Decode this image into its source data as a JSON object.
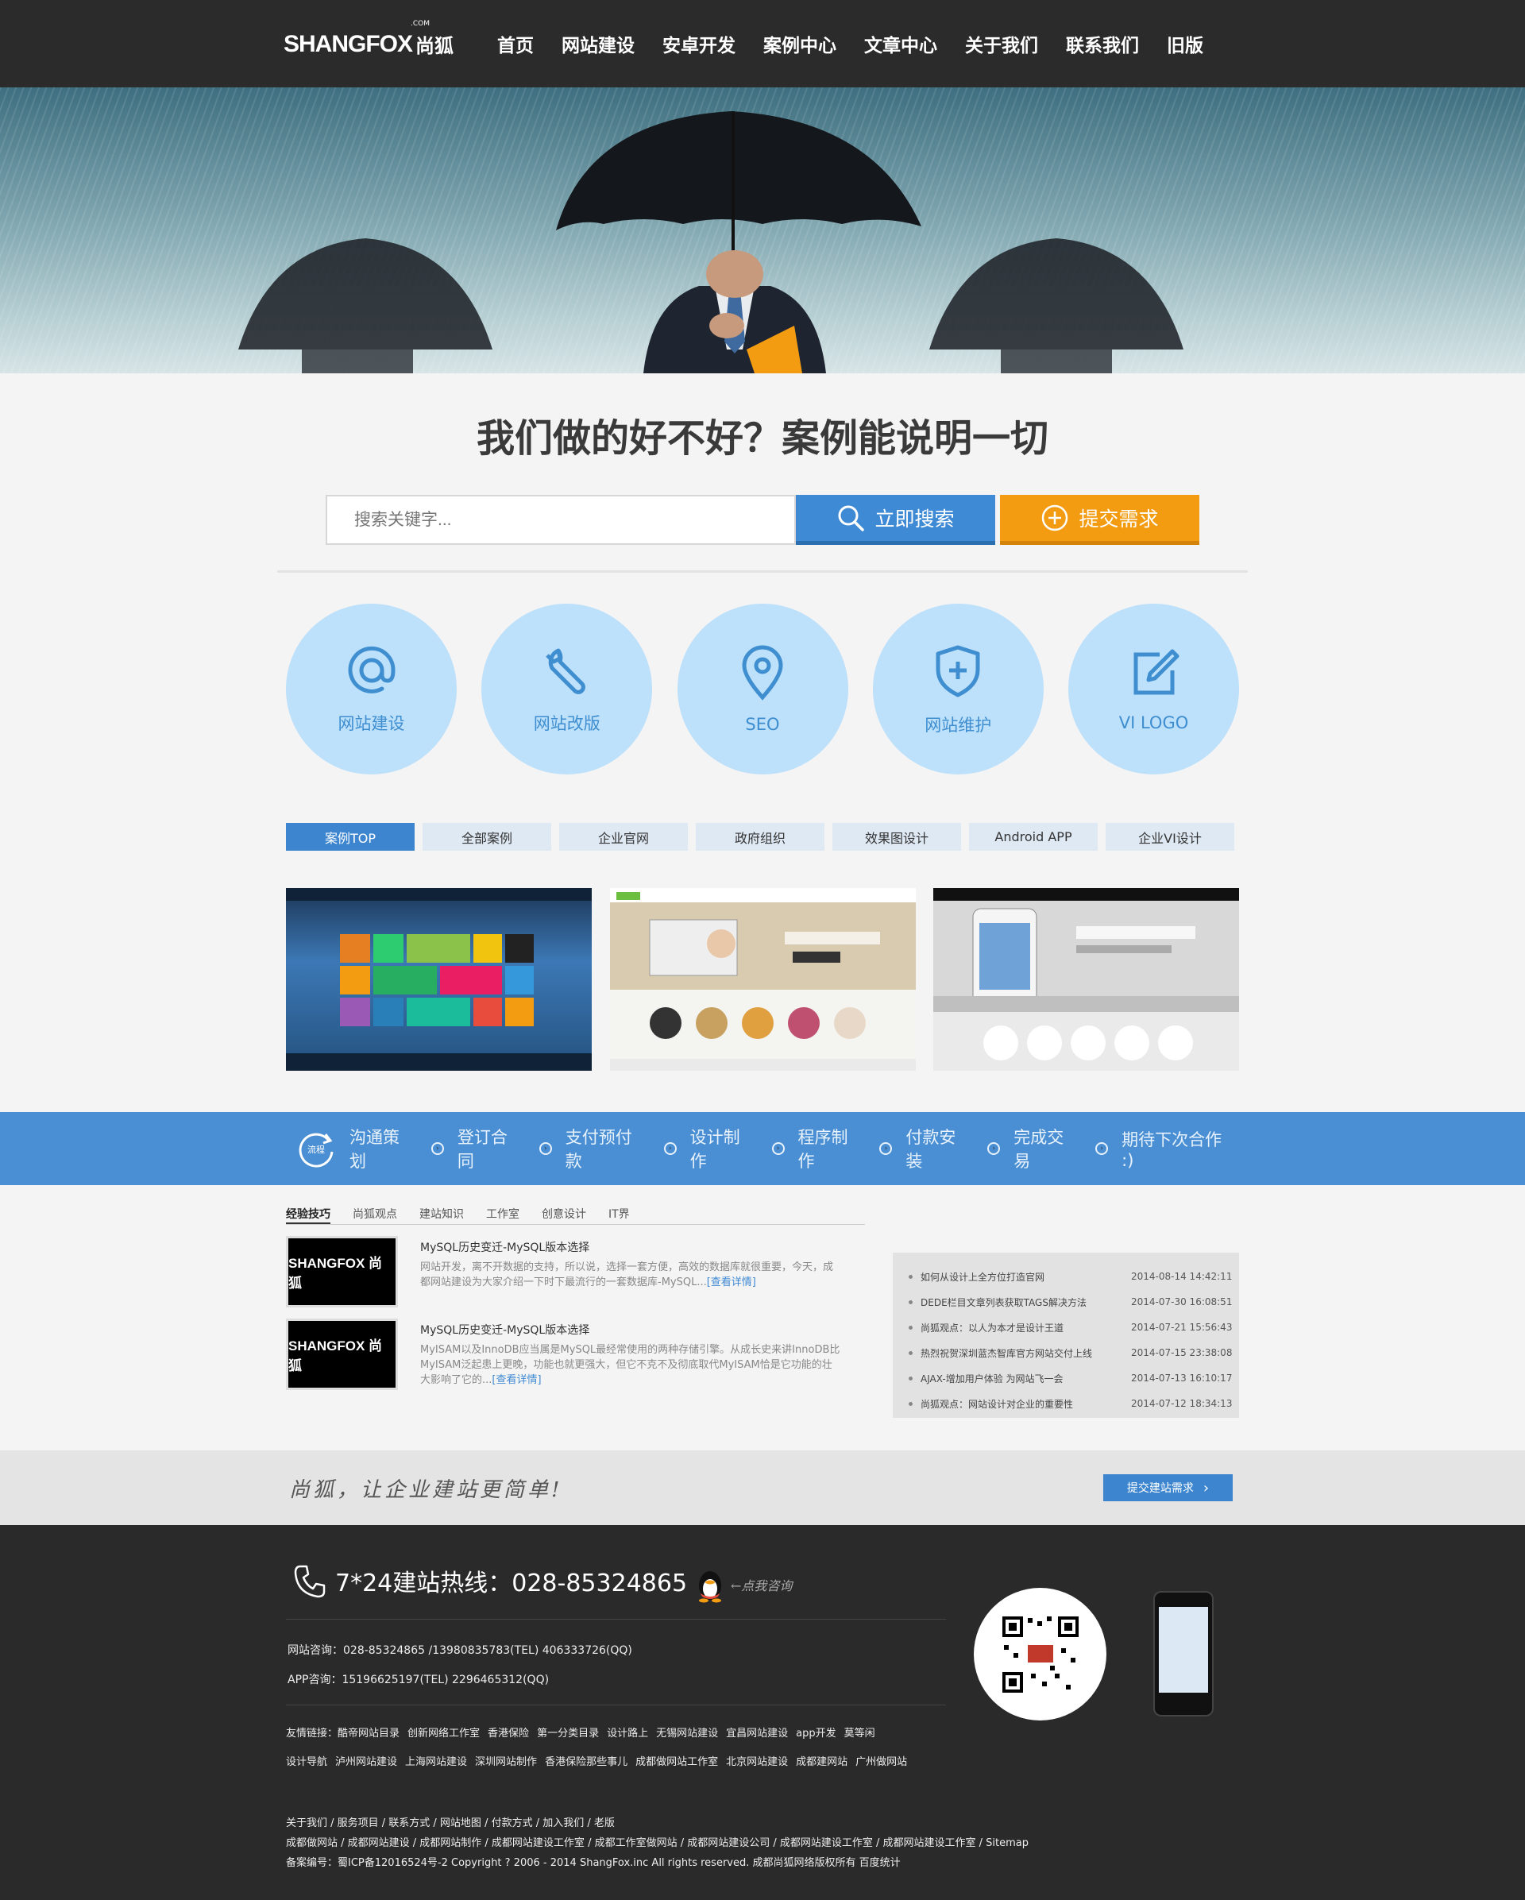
{
  "header": {
    "logo_text": "SHANGFOX",
    "logo_cn": "尚狐",
    "logo_suffix": ".COM",
    "nav": [
      "首页",
      "网站建设",
      "安卓开发",
      "案例中心",
      "文章中心",
      "关于我们",
      "联系我们",
      "旧版"
    ]
  },
  "cases": {
    "headline": "我们做的好不好？案例能说明一切",
    "search_placeholder": "搜索关键字...",
    "search_button": "立即搜索",
    "submit_button": "提交需求"
  },
  "services": [
    "网站建设",
    "网站改版",
    "SEO",
    "网站维护",
    "VI LOGO"
  ],
  "case_tabs": [
    "案例TOP",
    "全部案例",
    "企业官网",
    "政府组织",
    "效果图设计",
    "Android APP",
    "企业VI设计"
  ],
  "process": {
    "badge": "流程",
    "steps": [
      "沟通策划",
      "登订合同",
      "支付预付款",
      "设计制作",
      "程序制作",
      "付款安装",
      "完成交易",
      "期待下次合作 :)"
    ]
  },
  "news": {
    "tabs": [
      "经验技巧",
      "尚狐观点",
      "建站知识",
      "工作室",
      "创意设计",
      "IT界"
    ],
    "articles": [
      {
        "thumb": "SHANGFOX 尚狐",
        "title": "MySQL历史变迁-MySQL版本选择",
        "desc": "网站开发，离不开数据的支持，所以说，选择一套方便，高效的数据库就很重要，今天，成都网站建设为大家介绍一下时下最流行的一套数据库-MySQL...",
        "more": "[查看详情]"
      },
      {
        "thumb": "SHANGFOX 尚狐",
        "title": "MySQL历史变迁-MySQL版本选择",
        "desc": "MyISAM以及InnoDB应当属是MySQL最经常使用的两种存储引擎。从成长史来讲InnoDB比MyISAM泛起患上更晚，功能也就更强大，但它不克不及彻底取代MyISAM恰是它功能的壮大影响了它的...",
        "more": "[查看详情]"
      }
    ],
    "list": [
      {
        "title": "如何从设计上全方位打造官网",
        "date": "2014-08-14  14:42:11"
      },
      {
        "title": "DEDE栏目文章列表获取TAGS解决方法",
        "date": "2014-07-30  16:08:51"
      },
      {
        "title": "尚狐观点：以人为本才是设计王道",
        "date": "2014-07-21  15:56:43"
      },
      {
        "title": "热烈祝贺深圳蓝杰智库官方网站交付上线",
        "date": "2014-07-15  23:38:08"
      },
      {
        "title": "AJAX-增加用户体验 为网站飞一会",
        "date": "2014-07-13  16:10:17"
      },
      {
        "title": "尚狐观点：网站设计对企业的重要性",
        "date": "2014-07-12  18:34:13"
      }
    ]
  },
  "slogan": {
    "text": "尚狐，让企业建站更简单!",
    "button": "提交建站需求"
  },
  "footer": {
    "hotline": "7*24建站热线：028-85324865",
    "qq_text": "←点我咨询",
    "contact_web": "网站咨询：028-85324865 /13980835783(TEL) 406333726(QQ)",
    "contact_app": "APP咨询：15196625197(TEL) 2296465312(QQ)",
    "friend_links_label": "友情链接：",
    "friend_links": [
      "酷帝网站目录",
      "创新网络工作室",
      "香港保险",
      "第一分类目录",
      "设计路上",
      "无锡网站建设",
      "宜昌网站建设",
      "app开发",
      "莫等闲",
      "设计导航",
      "泸州网站建设",
      "上海网站建设",
      "深圳网站制作",
      "香港保险那些事儿",
      "成都做网站工作室",
      "北京网站建设",
      "成都建网站",
      "广州做网站"
    ],
    "bottom_nav": "关于我们 / 服务项目 / 联系方式 / 网站地图 / 付款方式 / 加入我们 / 老版",
    "bottom_keywords": "成都做网站 / 成都网站建设 / 成都网站制作 / 成都网站建设工作室 / 成都工作室做网站 / 成都网站建设公司 / 成都网站建设工作室 / 成都网站建设工作室 / Sitemap",
    "copyright": "备案编号：蜀ICP备12016524号-2 Copyright ? 2006 - 2014 ShangFox.inc All rights reserved. 成都尚狐网络版权所有 百度统计"
  },
  "colors": {
    "accent_blue": "#3f8ad4",
    "accent_orange": "#f39c12",
    "header_bg": "#2b2b2b",
    "circle_bg": "#bde0fb"
  }
}
